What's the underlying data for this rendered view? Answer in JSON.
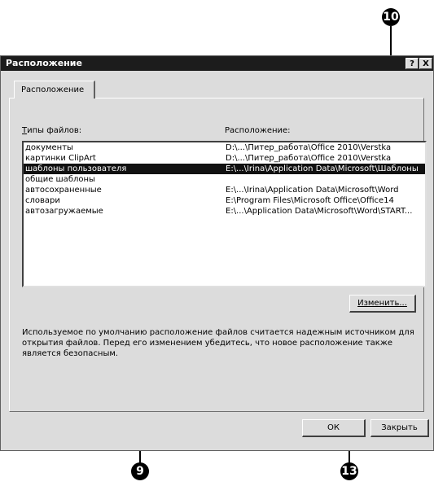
{
  "dialog": {
    "title": "Расположение",
    "help_label": "?",
    "close_label": "X"
  },
  "tab": {
    "label": "Расположение"
  },
  "columns": {
    "type_header": "Типы файлов:",
    "location_header": "Расположение:"
  },
  "rows": [
    {
      "type": "документы",
      "location": "D:\\...\\Питер_работа\\Office 2010\\Verstka"
    },
    {
      "type": "картинки ClipArt",
      "location": "D:\\...\\Питер_работа\\Office 2010\\Verstka"
    },
    {
      "type": "шаблоны пользователя",
      "location": "E:\\...\\Irina\\Application Data\\Microsoft\\Шаблоны"
    },
    {
      "type": "общие шаблоны",
      "location": ""
    },
    {
      "type": "автосохраненные",
      "location": "E:\\...\\Irina\\Application Data\\Microsoft\\Word"
    },
    {
      "type": "словари",
      "location": "E:\\Program Files\\Microsoft Office\\Office14"
    },
    {
      "type": "автозагружаемые",
      "location": "E:\\...\\Application Data\\Microsoft\\Word\\START..."
    }
  ],
  "selected_row": 2,
  "buttons": {
    "change": "Изменить...",
    "ok": "ОК",
    "close": "Закрыть"
  },
  "info_text": "Используемое по умолчанию расположение файлов считается надежным источником для открытия файлов. Перед его изменением убедитесь, что новое расположение также является безопасным.",
  "callouts": {
    "top": "10",
    "bottom_left": "9",
    "bottom_right": "13"
  }
}
